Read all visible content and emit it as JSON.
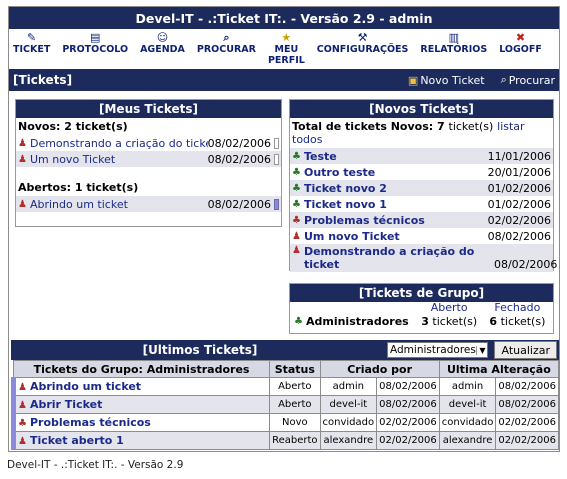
{
  "app_title": "Devel-IT - .:Ticket IT:. - Versão 2.9 - admin",
  "menu": [
    {
      "icon": "✎",
      "label": "TICKET"
    },
    {
      "icon": "▤",
      "label": "PROTOCOLO"
    },
    {
      "icon": "☺",
      "label": "AGENDA"
    },
    {
      "icon": "⌕",
      "label": "PROCURAR"
    },
    {
      "icon": "★",
      "label": "MEU\nPERFIL"
    },
    {
      "icon": "⚒",
      "label": "CONFIGURAÇÕES"
    },
    {
      "icon": "▥",
      "label": "RELATÓRIOS"
    },
    {
      "icon": "✖",
      "label": "LOGOFF"
    }
  ],
  "section": {
    "title": "[Tickets]",
    "new_ticket": "Novo Ticket",
    "search": "Procurar"
  },
  "meus_tickets": {
    "title": "[Meus Tickets]",
    "novos_label": "Novos: 2 ticket(s)",
    "novos": [
      {
        "name": "Demonstrando a criação do ticket",
        "date": "08/02/2006"
      },
      {
        "name": "Um novo Ticket",
        "date": "08/02/2006"
      }
    ],
    "abertos_label": "Abertos: 1 ticket(s)",
    "abertos": [
      {
        "name": "Abrindo um ticket",
        "date": "08/02/2006"
      }
    ]
  },
  "novos_tickets": {
    "title": "[Novos Tickets]",
    "total_label": "Total de tickets Novos:",
    "total_count": "7",
    "total_suffix": "ticket(s)",
    "list_all": "listar todos",
    "items": [
      {
        "name": "Teste",
        "date": "11/01/2006"
      },
      {
        "name": "Outro teste",
        "date": "20/01/2006"
      },
      {
        "name": "Ticket novo 2",
        "date": "01/02/2006"
      },
      {
        "name": "Ticket novo 1",
        "date": "01/02/2006"
      },
      {
        "name": "Problemas técnicos",
        "date": "02/02/2006"
      },
      {
        "name": "Um novo Ticket",
        "date": "08/02/2006"
      },
      {
        "name": "Demonstrando a criação do ticket",
        "date": "08/02/2006"
      }
    ]
  },
  "grupo": {
    "title": "[Tickets de Grupo]",
    "col_aberto": "Aberto",
    "col_fechado": "Fechado",
    "group_name": "Administradores",
    "aberto_count": "3",
    "fechado_count": "6",
    "count_suffix": "ticket(s)"
  },
  "ultimos": {
    "title": "[Ultimos Tickets]",
    "select_value": "Administradores",
    "update_button": "Atualizar",
    "headers": [
      "Tickets do Grupo: Administradores",
      "Status",
      "Criado por",
      "Ultima Alteração"
    ],
    "rows": [
      {
        "name": "Abrindo um ticket",
        "status": "Aberto",
        "by": "admin",
        "date": "08/02/2006",
        "by2": "admin",
        "date2": "08/02/2006"
      },
      {
        "name": "Abrir Ticket",
        "status": "Aberto",
        "by": "devel-it",
        "date": "08/02/2006",
        "by2": "devel-it",
        "date2": "08/02/2006"
      },
      {
        "name": "Problemas técnicos",
        "status": "Novo",
        "by": "convidado",
        "date": "02/02/2006",
        "by2": "convidado",
        "date2": "02/02/2006"
      },
      {
        "name": "Ticket aberto 1",
        "status": "Reaberto",
        "by": "alexandre",
        "date": "02/02/2006",
        "by2": "alexandre",
        "date2": "02/02/2006"
      }
    ]
  },
  "footer": "Devel-IT - .:Ticket IT:. - Versão 2.9"
}
